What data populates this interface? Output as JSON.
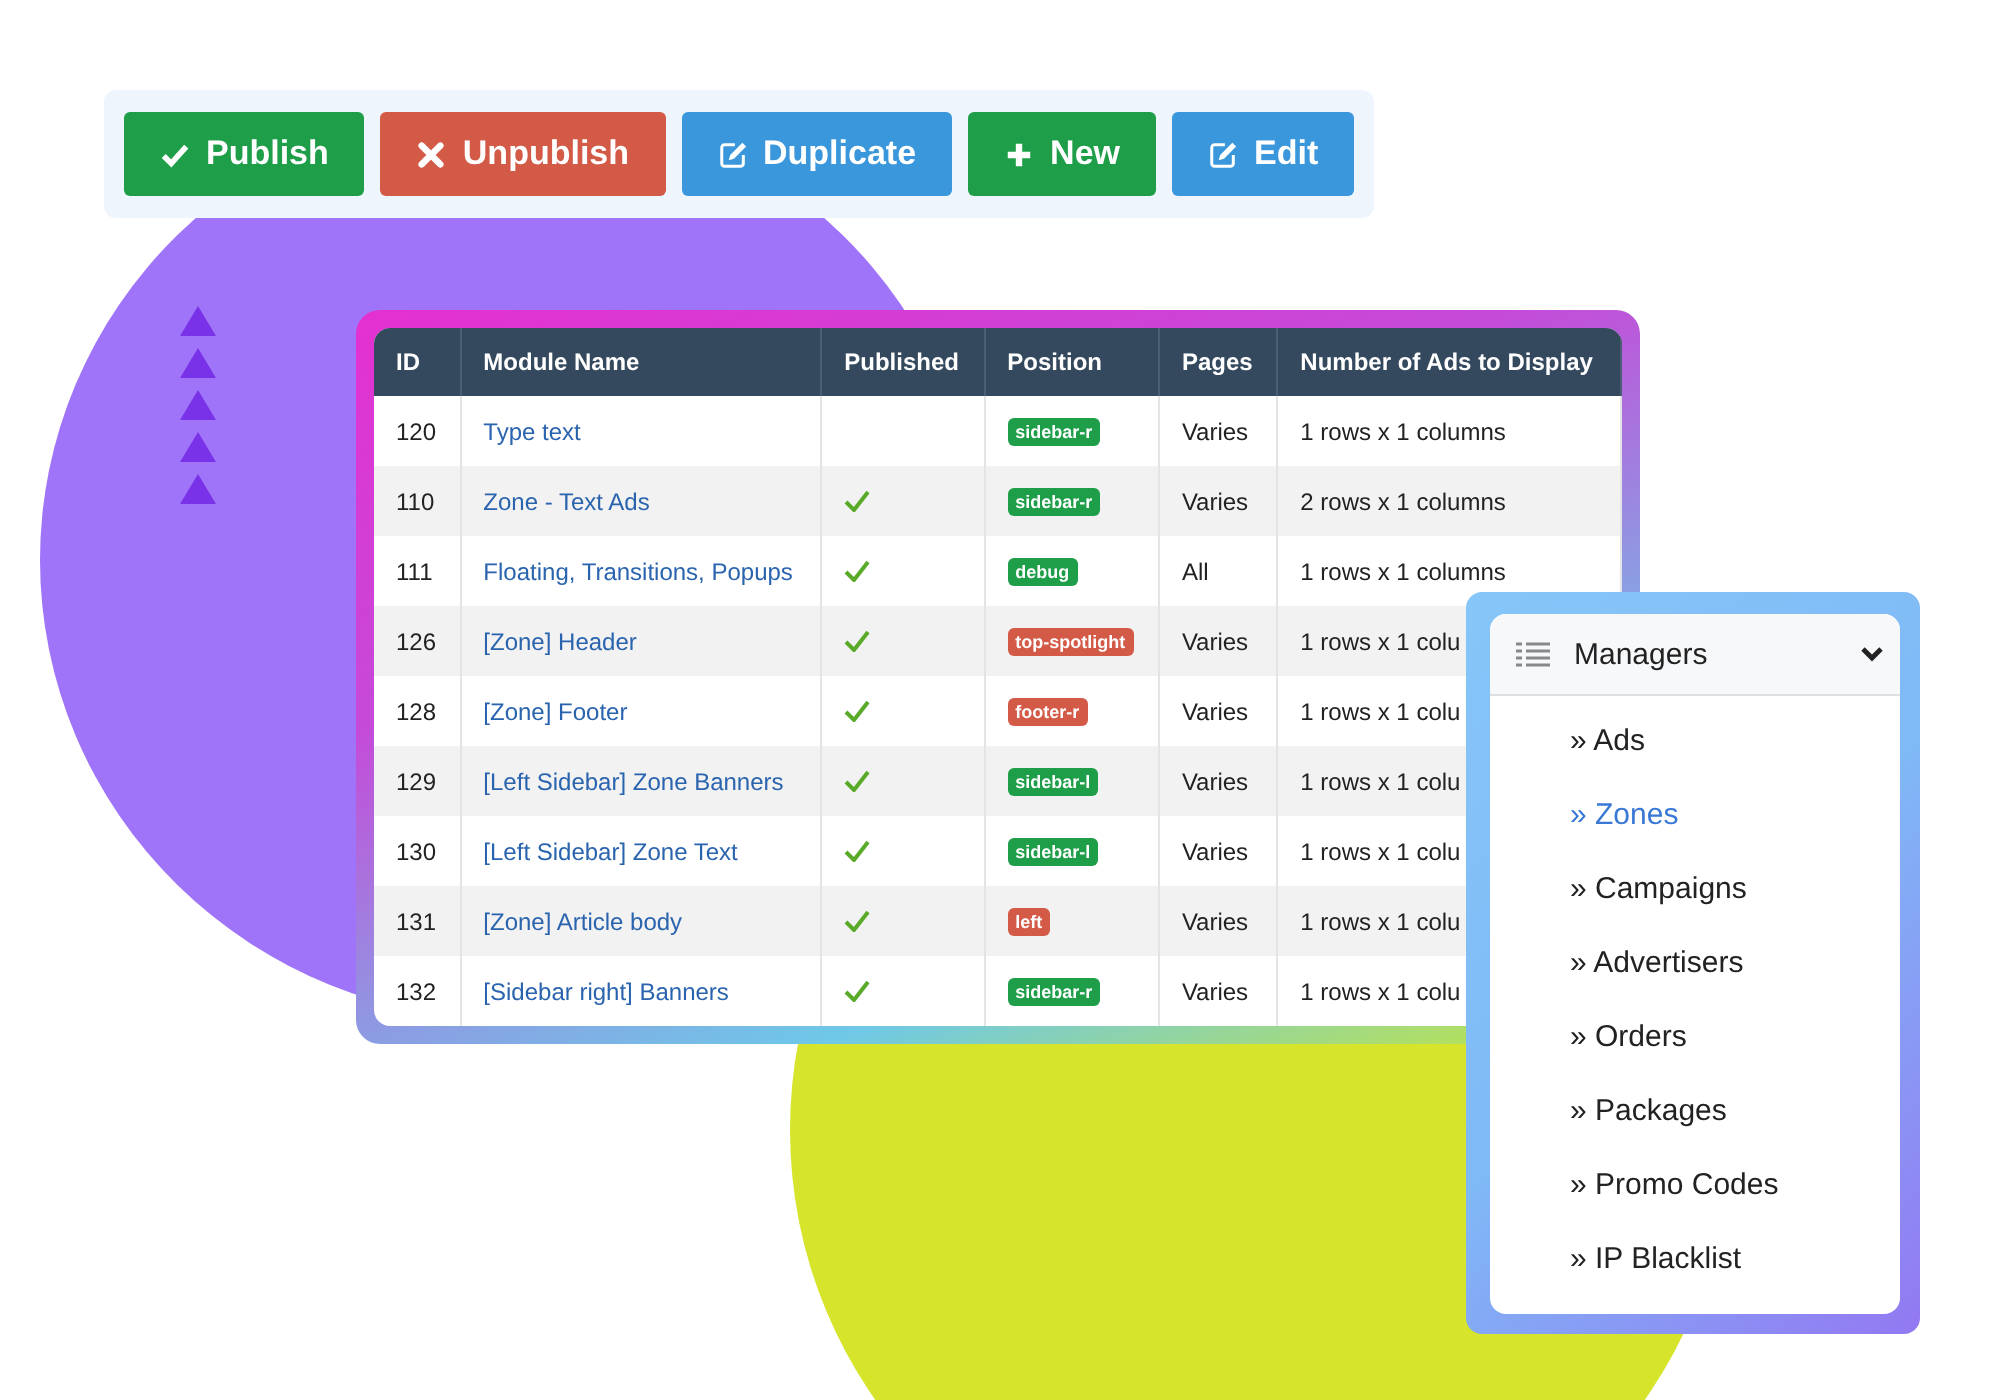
{
  "toolbar": {
    "buttons": [
      {
        "kind": "publish",
        "label": "Publish"
      },
      {
        "kind": "unpublish",
        "label": "Unpublish"
      },
      {
        "kind": "duplicate",
        "label": "Duplicate"
      },
      {
        "kind": "new",
        "label": "New"
      },
      {
        "kind": "edit",
        "label": "Edit"
      }
    ]
  },
  "table": {
    "columns": [
      "ID",
      "Module Name",
      "Published",
      "Position",
      "Pages",
      "Number of Ads to Display"
    ],
    "rows": [
      {
        "id": "120",
        "name": "Type text",
        "published": false,
        "position": {
          "label": "sidebar-r",
          "color": "#1e9e48"
        },
        "pages": "Varies",
        "display": "1 rows x 1 columns"
      },
      {
        "id": "110",
        "name": "Zone - Text Ads",
        "published": true,
        "position": {
          "label": "sidebar-r",
          "color": "#1e9e48"
        },
        "pages": "Varies",
        "display": "2 rows x 1 columns"
      },
      {
        "id": "111",
        "name": "Floating, Transitions, Popups",
        "published": true,
        "position": {
          "label": "debug",
          "color": "#1e9e48"
        },
        "pages": "All",
        "display": "1 rows x 1 columns"
      },
      {
        "id": "126",
        "name": "[Zone] Header",
        "published": true,
        "position": {
          "label": "top-spotlight",
          "color": "#d35a47"
        },
        "pages": "Varies",
        "display": "1 rows x 1 colu"
      },
      {
        "id": "128",
        "name": "[Zone] Footer",
        "published": true,
        "position": {
          "label": "footer-r",
          "color": "#d35a47"
        },
        "pages": "Varies",
        "display": "1 rows x 1 colu"
      },
      {
        "id": "129",
        "name": "[Left Sidebar] Zone Banners",
        "published": true,
        "position": {
          "label": "sidebar-l",
          "color": "#1e9e48"
        },
        "pages": "Varies",
        "display": "1 rows x 1 colu"
      },
      {
        "id": "130",
        "name": "[Left Sidebar] Zone Text",
        "published": true,
        "position": {
          "label": "sidebar-l",
          "color": "#1e9e48"
        },
        "pages": "Varies",
        "display": "1 rows x 1 colu"
      },
      {
        "id": "131",
        "name": "[Zone] Article body",
        "published": true,
        "position": {
          "label": "left",
          "color": "#d35a47"
        },
        "pages": "Varies",
        "display": "1 rows x 1 colu"
      },
      {
        "id": "132",
        "name": "[Sidebar right] Banners",
        "published": true,
        "position": {
          "label": "sidebar-r",
          "color": "#1e9e48"
        },
        "pages": "Varies",
        "display": "1 rows x 1 colu"
      }
    ]
  },
  "menu": {
    "title": "Managers",
    "expanded": true,
    "items": [
      {
        "label": "» Ads",
        "selected": false
      },
      {
        "label": "» Zones",
        "selected": true
      },
      {
        "label": "» Campaigns",
        "selected": false
      },
      {
        "label": "» Advertisers",
        "selected": false
      },
      {
        "label": "» Orders",
        "selected": false
      },
      {
        "label": "» Packages",
        "selected": false
      },
      {
        "label": "» Promo Codes",
        "selected": false
      },
      {
        "label": "» IP Blacklist",
        "selected": false
      }
    ]
  }
}
